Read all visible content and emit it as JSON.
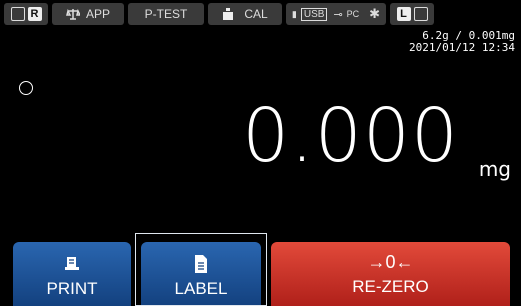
{
  "status": {
    "mode_letter": "R",
    "app_label": "APP",
    "ptest_label": "P-TEST",
    "cal_label": "CAL",
    "usb_label": "USB",
    "pc_label": "PC",
    "right_letter": "L"
  },
  "info": {
    "range": "6.2g / 0.001mg",
    "datetime": "2021/01/12 12:34"
  },
  "display": {
    "value": "0.000",
    "unit": "mg"
  },
  "buttons": {
    "print_label": "PRINT",
    "label_label": "LABEL",
    "rezero_label": "RE-ZERO",
    "rezero_symbol": "→0←"
  }
}
